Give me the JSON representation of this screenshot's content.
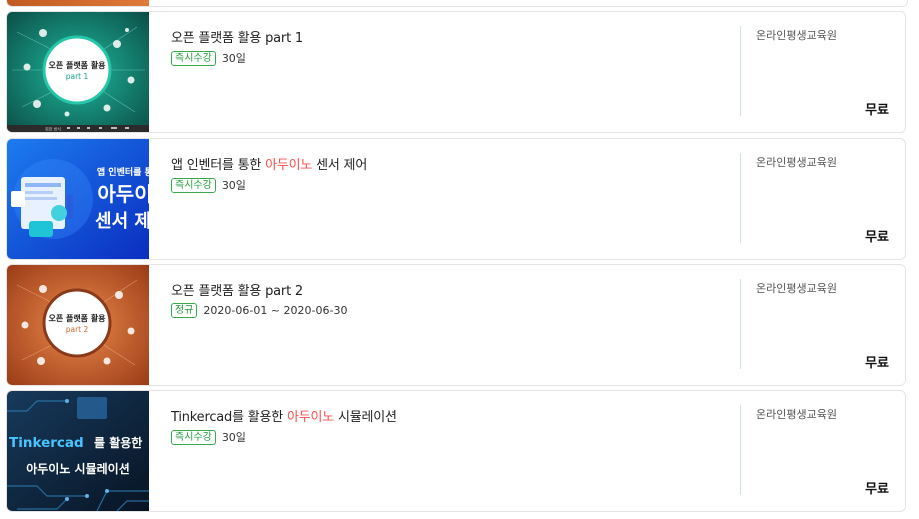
{
  "courses": [
    {
      "title_parts": [
        "오픈 플랫폼 활용 part 1",
        "",
        ""
      ],
      "badge": "즉시수강",
      "period": "30일",
      "provider": "온라인평생교육원",
      "price": "무료",
      "thumb": {
        "line1": "오픈 플랫폼 활용",
        "line2": "part 1",
        "bg": [
          "#0f5f55",
          "#18a08a"
        ],
        "accent": "#18a08a",
        "footer": "회전 방식"
      }
    },
    {
      "title_parts": [
        "앱 인벤터를 통한 ",
        "아두이노",
        " 센서 제어"
      ],
      "badge": "즉시수강",
      "period": "30일",
      "provider": "온라인평생교육원",
      "price": "무료",
      "thumb": {
        "line1": "앱 인벤터를 통한",
        "line2": "아두이",
        "line3": "센서 제",
        "bg": [
          "#0c2fbf",
          "#1f6ff2"
        ]
      }
    },
    {
      "title_parts": [
        "오픈 플랫폼 활용 part 2",
        "",
        ""
      ],
      "badge": "정규",
      "period": "2020-06-01 ~ 2020-06-30",
      "provider": "온라인평생교육원",
      "price": "무료",
      "thumb": {
        "line1": "오픈 플랫폼 활용",
        "line2": "part 2",
        "bg": [
          "#a8431b",
          "#e5823f"
        ],
        "accent": "#c76a2e"
      }
    },
    {
      "title_parts": [
        "Tinkercad를 활용한 ",
        "아두이노",
        " 시뮬레이션"
      ],
      "badge": "즉시수강",
      "period": "30일",
      "provider": "온라인평생교육원",
      "price": "무료",
      "thumb": {
        "line1a": "Tinkercad",
        "line1b": "를 활용한",
        "line2": "아두이노 시뮬레이션",
        "bg": [
          "#0a1a2e",
          "#173a5c"
        ]
      }
    }
  ]
}
